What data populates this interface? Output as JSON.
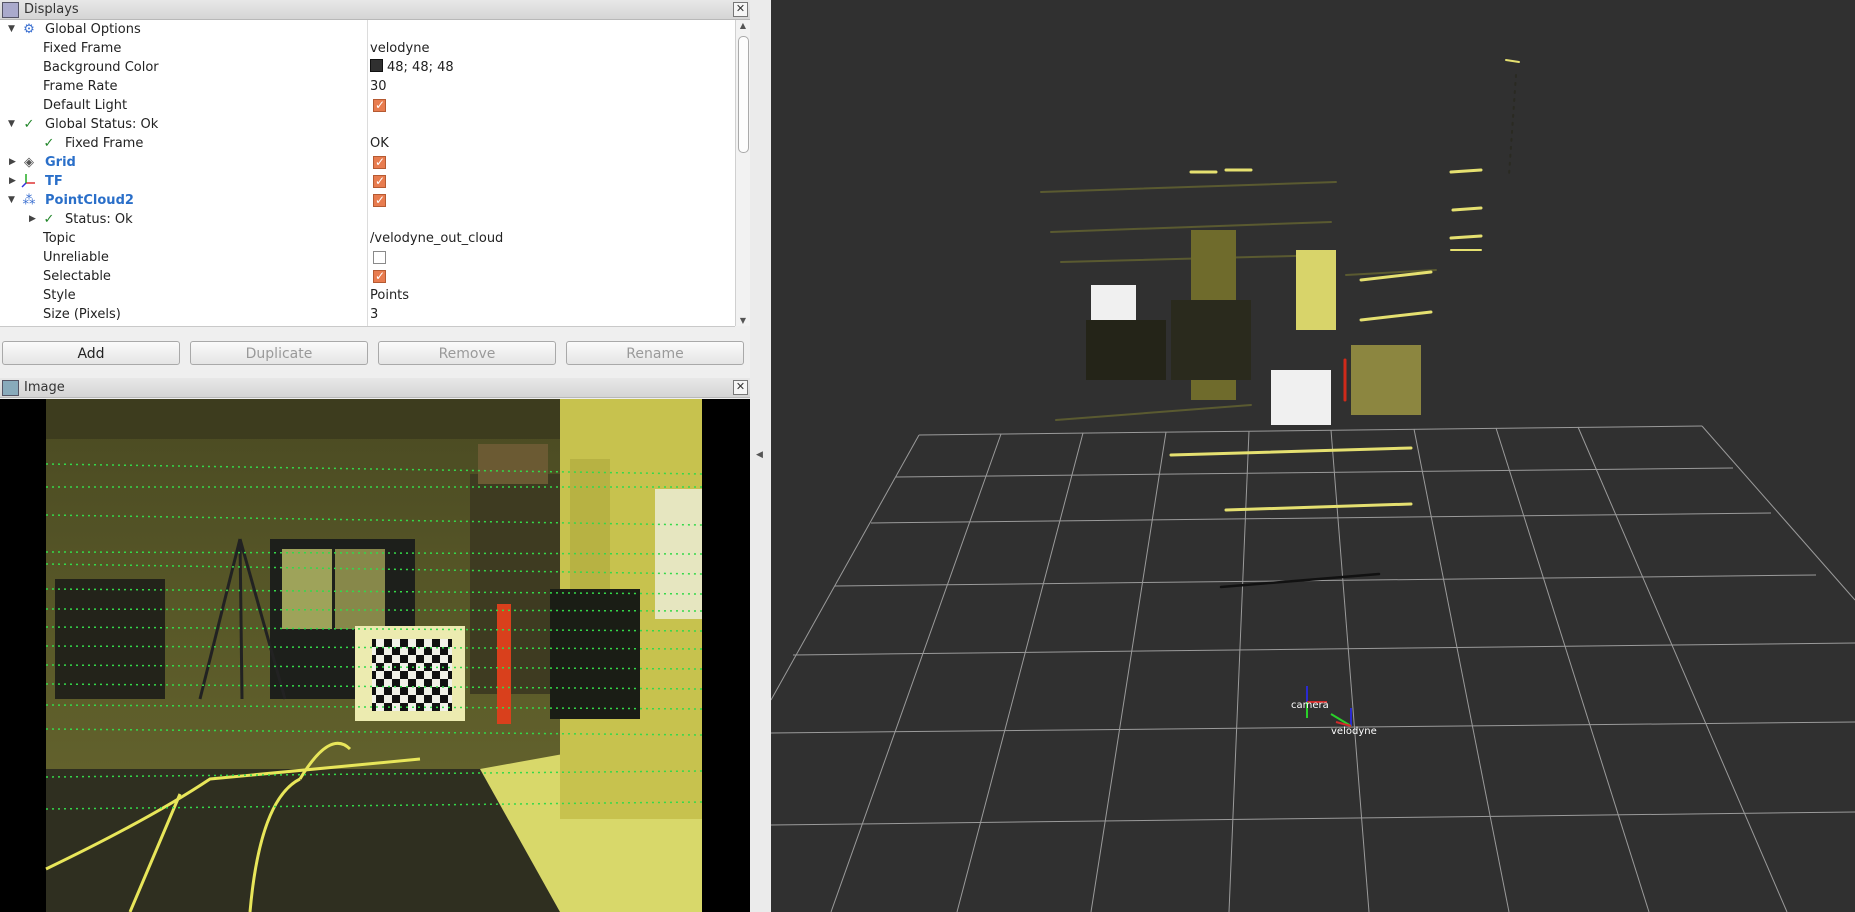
{
  "displays_panel": {
    "title": "Displays",
    "close_glyph": "✕",
    "tree": {
      "global_options": {
        "label": "Global Options",
        "icon": "gear-icon"
      },
      "fixed_frame": {
        "label": "Fixed Frame",
        "value": "velodyne"
      },
      "background_color": {
        "label": "Background Color",
        "value": "48; 48; 48",
        "color": "#303030"
      },
      "frame_rate": {
        "label": "Frame Rate",
        "value": "30"
      },
      "default_light": {
        "label": "Default Light",
        "checked": true
      },
      "global_status": {
        "label": "Global Status: Ok"
      },
      "gs_fixed_frame": {
        "label": "Fixed Frame",
        "value": "OK"
      },
      "grid": {
        "label": "Grid",
        "checked": true,
        "icon": "grid-icon"
      },
      "tf": {
        "label": "TF",
        "checked": true,
        "icon": "tf-axes-icon"
      },
      "pointcloud2": {
        "label": "PointCloud2",
        "checked": true,
        "icon": "pointcloud-icon"
      },
      "pc_status": {
        "label": "Status: Ok"
      },
      "topic": {
        "label": "Topic",
        "value": "/velodyne_out_cloud"
      },
      "unreliable": {
        "label": "Unreliable",
        "checked": false
      },
      "selectable": {
        "label": "Selectable",
        "checked": true
      },
      "style": {
        "label": "Style",
        "value": "Points"
      },
      "size_pixels": {
        "label": "Size (Pixels)",
        "value": "3"
      }
    },
    "buttons": {
      "add": "Add",
      "duplicate": "Duplicate",
      "remove": "Remove",
      "rename": "Rename"
    }
  },
  "image_panel": {
    "title": "Image",
    "close_glyph": "✕"
  },
  "view3d": {
    "frame_labels": {
      "camera": "camera",
      "velodyne": "velodyne"
    }
  },
  "colors": {
    "checkbox_on": "#e87c4f",
    "tree_link": "#2a6fc9",
    "status_ok": "#22862a",
    "viewport_bg": "#303030",
    "grid_line": "#9a9a9a"
  }
}
